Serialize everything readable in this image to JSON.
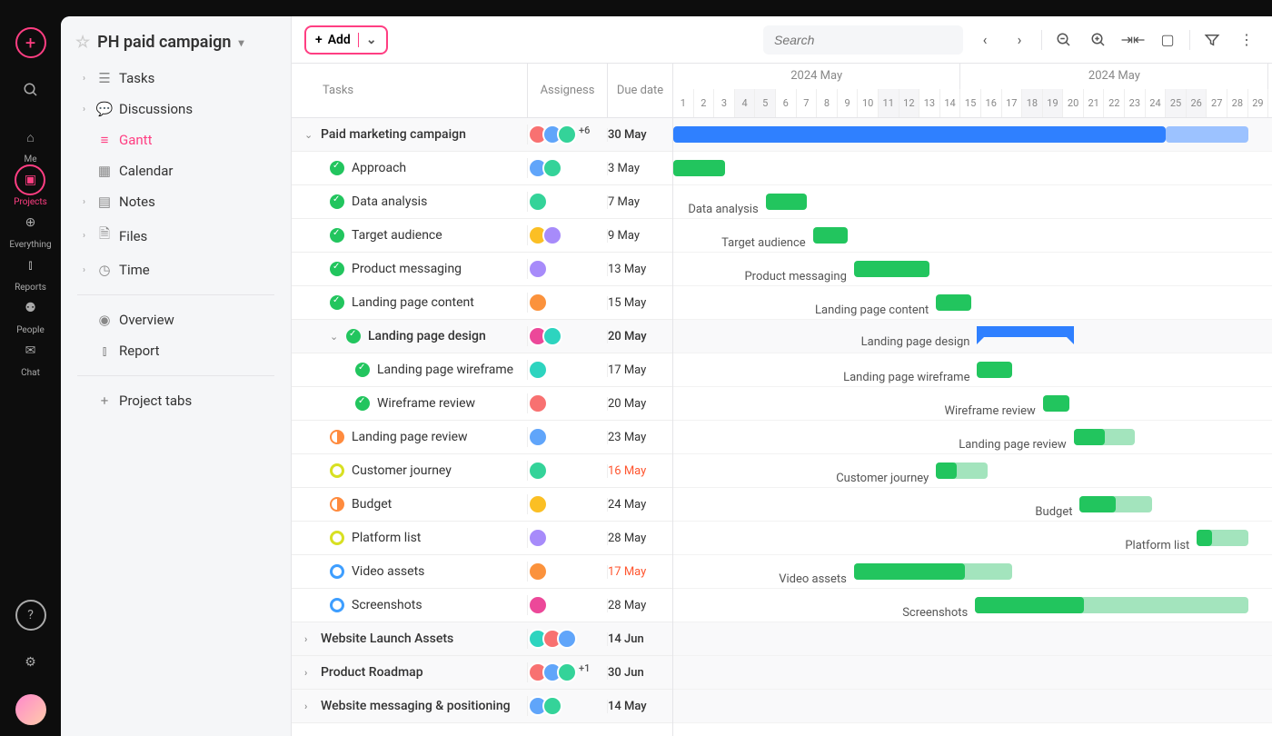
{
  "rail": {
    "items": [
      {
        "name": "me",
        "label": "Me",
        "glyph": "⌂"
      },
      {
        "name": "projects",
        "label": "Projects",
        "glyph": "▣",
        "active": true
      },
      {
        "name": "everything",
        "label": "Everything",
        "glyph": "⊕"
      },
      {
        "name": "reports",
        "label": "Reports",
        "glyph": "⫾"
      },
      {
        "name": "people",
        "label": "People",
        "glyph": "⚉"
      },
      {
        "name": "chat",
        "label": "Chat",
        "glyph": "✉"
      }
    ]
  },
  "project": {
    "title": "PH paid campaign"
  },
  "sidebar": {
    "tasks": "Tasks",
    "discussions": "Discussions",
    "gantt": "Gantt",
    "calendar": "Calendar",
    "notes": "Notes",
    "files": "Files",
    "time": "Time",
    "overview": "Overview",
    "report": "Report",
    "project_tabs": "Project tabs"
  },
  "toolbar": {
    "add": "Add",
    "search_placeholder": "Search"
  },
  "headers": {
    "tasks": "Tasks",
    "assignees": "Assigness",
    "due": "Due date",
    "month": "2024 May"
  },
  "timeline": {
    "day_width": 22.6,
    "start_day": 1,
    "days": 29,
    "weekend_days": [
      4,
      5,
      11,
      12,
      18,
      19,
      25,
      26
    ]
  },
  "avatar_colors": [
    "#f87171",
    "#60a5fa",
    "#34d399",
    "#fbbf24",
    "#a78bfa",
    "#fb923c",
    "#ec4899",
    "#2dd4bf"
  ],
  "rows": [
    {
      "type": "group",
      "indent": 0,
      "expand": "open",
      "name": "Paid marketing campaign",
      "avatars": 3,
      "avplus": "+6",
      "due": "30 May",
      "bar": {
        "kind": "blue",
        "start": 1,
        "end": 25,
        "ext": 29
      }
    },
    {
      "type": "task",
      "indent": 1,
      "status": "done",
      "name": "Approach",
      "avatars": 2,
      "due": "3 May",
      "bar": {
        "kind": "green",
        "start": 1,
        "end": 3.5,
        "label": ""
      }
    },
    {
      "type": "task",
      "indent": 1,
      "status": "done",
      "name": "Data analysis",
      "avatars": 1,
      "due": "7 May",
      "bar": {
        "kind": "green",
        "start": 5.5,
        "end": 7.5,
        "label": "Data analysis"
      }
    },
    {
      "type": "task",
      "indent": 1,
      "status": "done",
      "name": "Target audience",
      "avatars": 2,
      "due": "9 May",
      "bar": {
        "kind": "green",
        "start": 7.8,
        "end": 9.5,
        "label": "Target audience"
      }
    },
    {
      "type": "task",
      "indent": 1,
      "status": "done",
      "name": "Product messaging",
      "avatars": 1,
      "due": "13 May",
      "bar": {
        "kind": "green",
        "start": 9.8,
        "end": 13.5,
        "label": "Product messaging"
      }
    },
    {
      "type": "task",
      "indent": 1,
      "status": "done",
      "name": "Landing page content",
      "avatars": 1,
      "due": "15 May",
      "bar": {
        "kind": "green",
        "start": 13.8,
        "end": 15.5,
        "label": "Landing page content"
      }
    },
    {
      "type": "group",
      "indent": 1,
      "expand": "open",
      "status": "done",
      "name": "Landing page design",
      "avatars": 2,
      "due": "20 May",
      "bar": {
        "kind": "bracket",
        "start": 15.8,
        "end": 20.5,
        "label": "Landing page design"
      }
    },
    {
      "type": "task",
      "indent": 2,
      "status": "done",
      "name": "Landing page wireframe",
      "avatars": 1,
      "due": "17 May",
      "bar": {
        "kind": "green",
        "start": 15.8,
        "end": 17.5,
        "label": "Landing page wireframe"
      }
    },
    {
      "type": "task",
      "indent": 2,
      "status": "done",
      "name": "Wireframe review",
      "avatars": 1,
      "due": "20 May",
      "bar": {
        "kind": "green",
        "start": 19,
        "end": 20.3,
        "label": "Wireframe review"
      }
    },
    {
      "type": "task",
      "indent": 1,
      "status": "half-orange",
      "name": "Landing page review",
      "avatars": 1,
      "due": "23 May",
      "bar": {
        "kind": "green-prog",
        "start": 20.5,
        "end": 23.5,
        "prog": 0.5,
        "label": "Landing page review"
      }
    },
    {
      "type": "task",
      "indent": 1,
      "status": "ring-yellow",
      "name": "Customer journey",
      "avatars": 1,
      "due": "16 May",
      "overdue": true,
      "bar": {
        "kind": "green-prog",
        "start": 13.8,
        "end": 16.3,
        "prog": 0.4,
        "label": "Customer journey"
      }
    },
    {
      "type": "task",
      "indent": 1,
      "status": "half-orange",
      "name": "Budget",
      "avatars": 1,
      "due": "24 May",
      "bar": {
        "kind": "green-prog",
        "start": 20.8,
        "end": 24.3,
        "prog": 0.5,
        "label": "Budget"
      }
    },
    {
      "type": "task",
      "indent": 1,
      "status": "ring-yellow",
      "name": "Platform list",
      "avatars": 1,
      "due": "28 May",
      "bar": {
        "kind": "green-prog",
        "start": 26.5,
        "end": 29,
        "prog": 0.3,
        "label": "Platform list"
      }
    },
    {
      "type": "task",
      "indent": 1,
      "status": "ring-blue",
      "name": "Video assets",
      "avatars": 1,
      "due": "17 May",
      "overdue": true,
      "bar": {
        "kind": "green-prog",
        "start": 9.8,
        "end": 17.5,
        "prog": 0.7,
        "label": "Video assets"
      }
    },
    {
      "type": "task",
      "indent": 1,
      "status": "ring-blue",
      "name": "Screenshots",
      "avatars": 1,
      "due": "28 May",
      "bar": {
        "kind": "green-prog",
        "start": 15.7,
        "end": 29,
        "prog": 0.4,
        "label": "Screenshots"
      }
    },
    {
      "type": "group",
      "indent": 0,
      "expand": "closed",
      "name": "Website Launch Assets",
      "avatars": 3,
      "due": "14 Jun"
    },
    {
      "type": "group",
      "indent": 0,
      "expand": "closed",
      "name": "Product Roadmap",
      "avatars": 3,
      "avplus": "+1",
      "due": "30 Jun"
    },
    {
      "type": "group",
      "indent": 0,
      "expand": "closed",
      "name": "Website messaging & positioning",
      "avatars": 2,
      "due": "14 May"
    }
  ]
}
